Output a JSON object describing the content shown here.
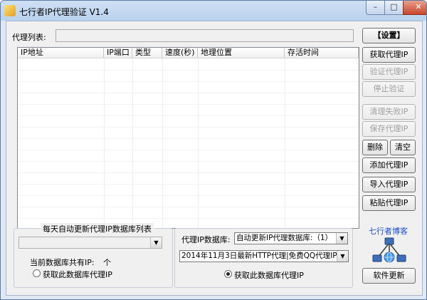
{
  "window": {
    "title": "七行者IP代理验证 V1.4",
    "minimize": "–",
    "maximize": "□",
    "close": "✕"
  },
  "proxy_list_label": "代理列表:",
  "table": {
    "columns": [
      "IP地址",
      "IP端口",
      "类型",
      "速度(秒)",
      "地理位置",
      "存活时间"
    ]
  },
  "buttons": {
    "settings": "【设置】",
    "fetch_proxy": "获取代理IP",
    "verify_proxy": "验证代理IP",
    "stop_verify": "停止验证",
    "clear_failed": "清理失败IP",
    "save_proxy": "保存代理IP",
    "delete": "删除",
    "clear": "清空",
    "add_proxy": "添加代理IP",
    "import_proxy": "导入代理IP",
    "paste_proxy": "粘贴代理IP",
    "software_update": "软件更新"
  },
  "left_group": {
    "title": "每天自动更新代理IP数据库列表",
    "db_count_label": "当前数据库共有IP:",
    "db_count_unit": "个",
    "radio_label": "获取此数据库代理IP"
  },
  "right_group": {
    "db_label": "代理IP数据库:",
    "db_select": "自动更新IP代理数据库:（1）",
    "db_list_select": "2014年11月3日最新HTTP代理|免费QQ代理IP_在线代",
    "radio_label": "获取此数据库代理IP"
  },
  "blog": {
    "title": "七行者博客"
  }
}
